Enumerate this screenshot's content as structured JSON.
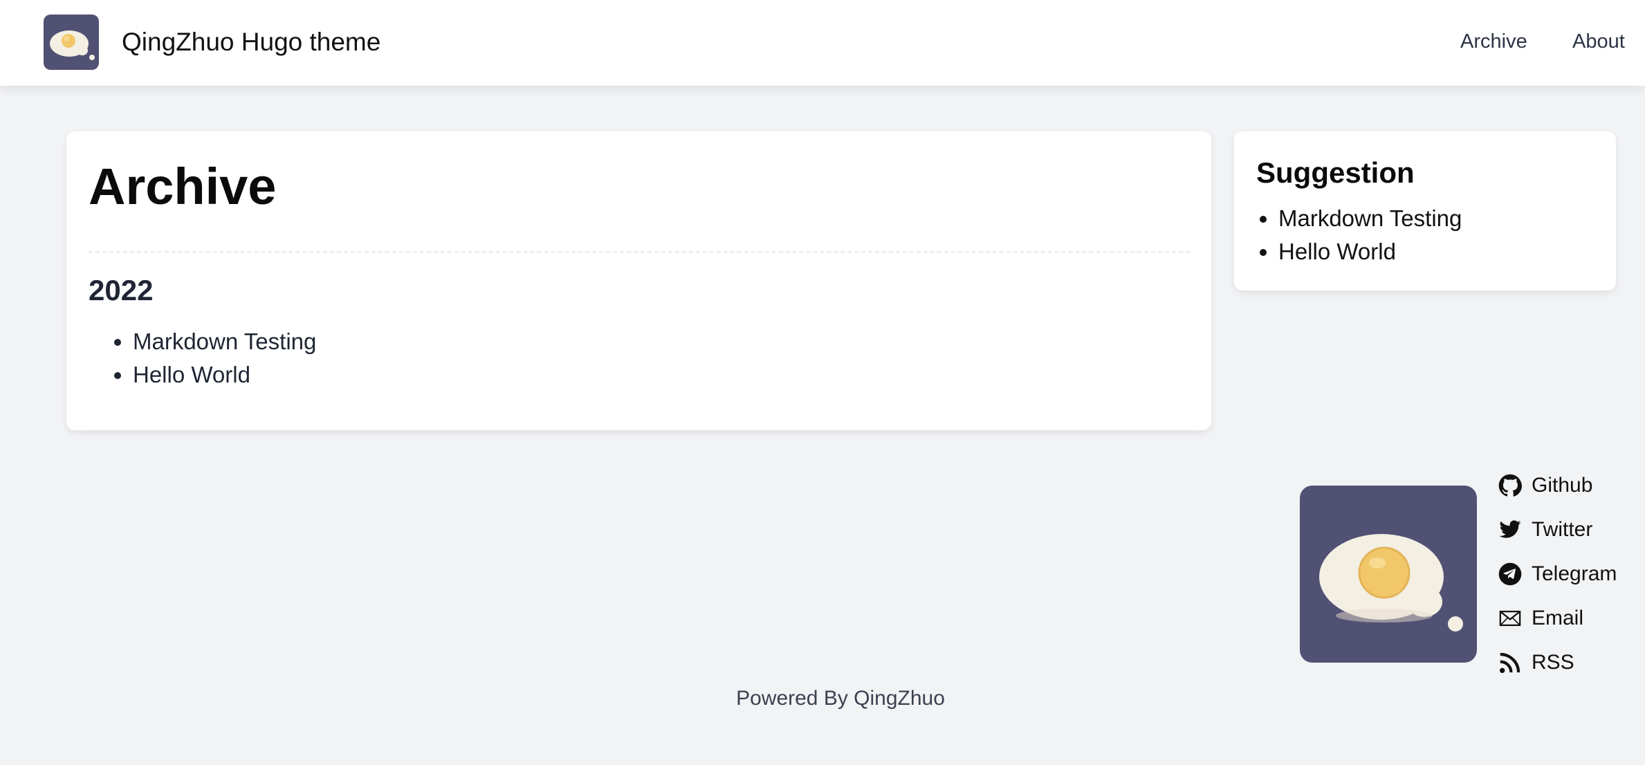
{
  "header": {
    "site_title": "QingZhuo Hugo theme",
    "nav": [
      {
        "label": "Archive"
      },
      {
        "label": "About"
      }
    ]
  },
  "main": {
    "title": "Archive",
    "groups": [
      {
        "year": "2022",
        "posts": [
          {
            "title": "Markdown Testing"
          },
          {
            "title": "Hello World"
          }
        ]
      }
    ]
  },
  "sidebar": {
    "title": "Suggestion",
    "items": [
      {
        "title": "Markdown Testing"
      },
      {
        "title": "Hello World"
      }
    ]
  },
  "social": [
    {
      "label": "Github",
      "icon": "github-icon"
    },
    {
      "label": "Twitter",
      "icon": "twitter-icon"
    },
    {
      "label": "Telegram",
      "icon": "telegram-icon"
    },
    {
      "label": "Email",
      "icon": "email-icon"
    },
    {
      "label": "RSS",
      "icon": "rss-icon"
    }
  ],
  "footer": {
    "text": "Powered By QingZhuo"
  },
  "colors": {
    "background": "#f2f3f5",
    "card": "#ffffff",
    "logo_bg": "#515174",
    "egg_white": "#f3efe3",
    "yolk": "#f2c769"
  }
}
